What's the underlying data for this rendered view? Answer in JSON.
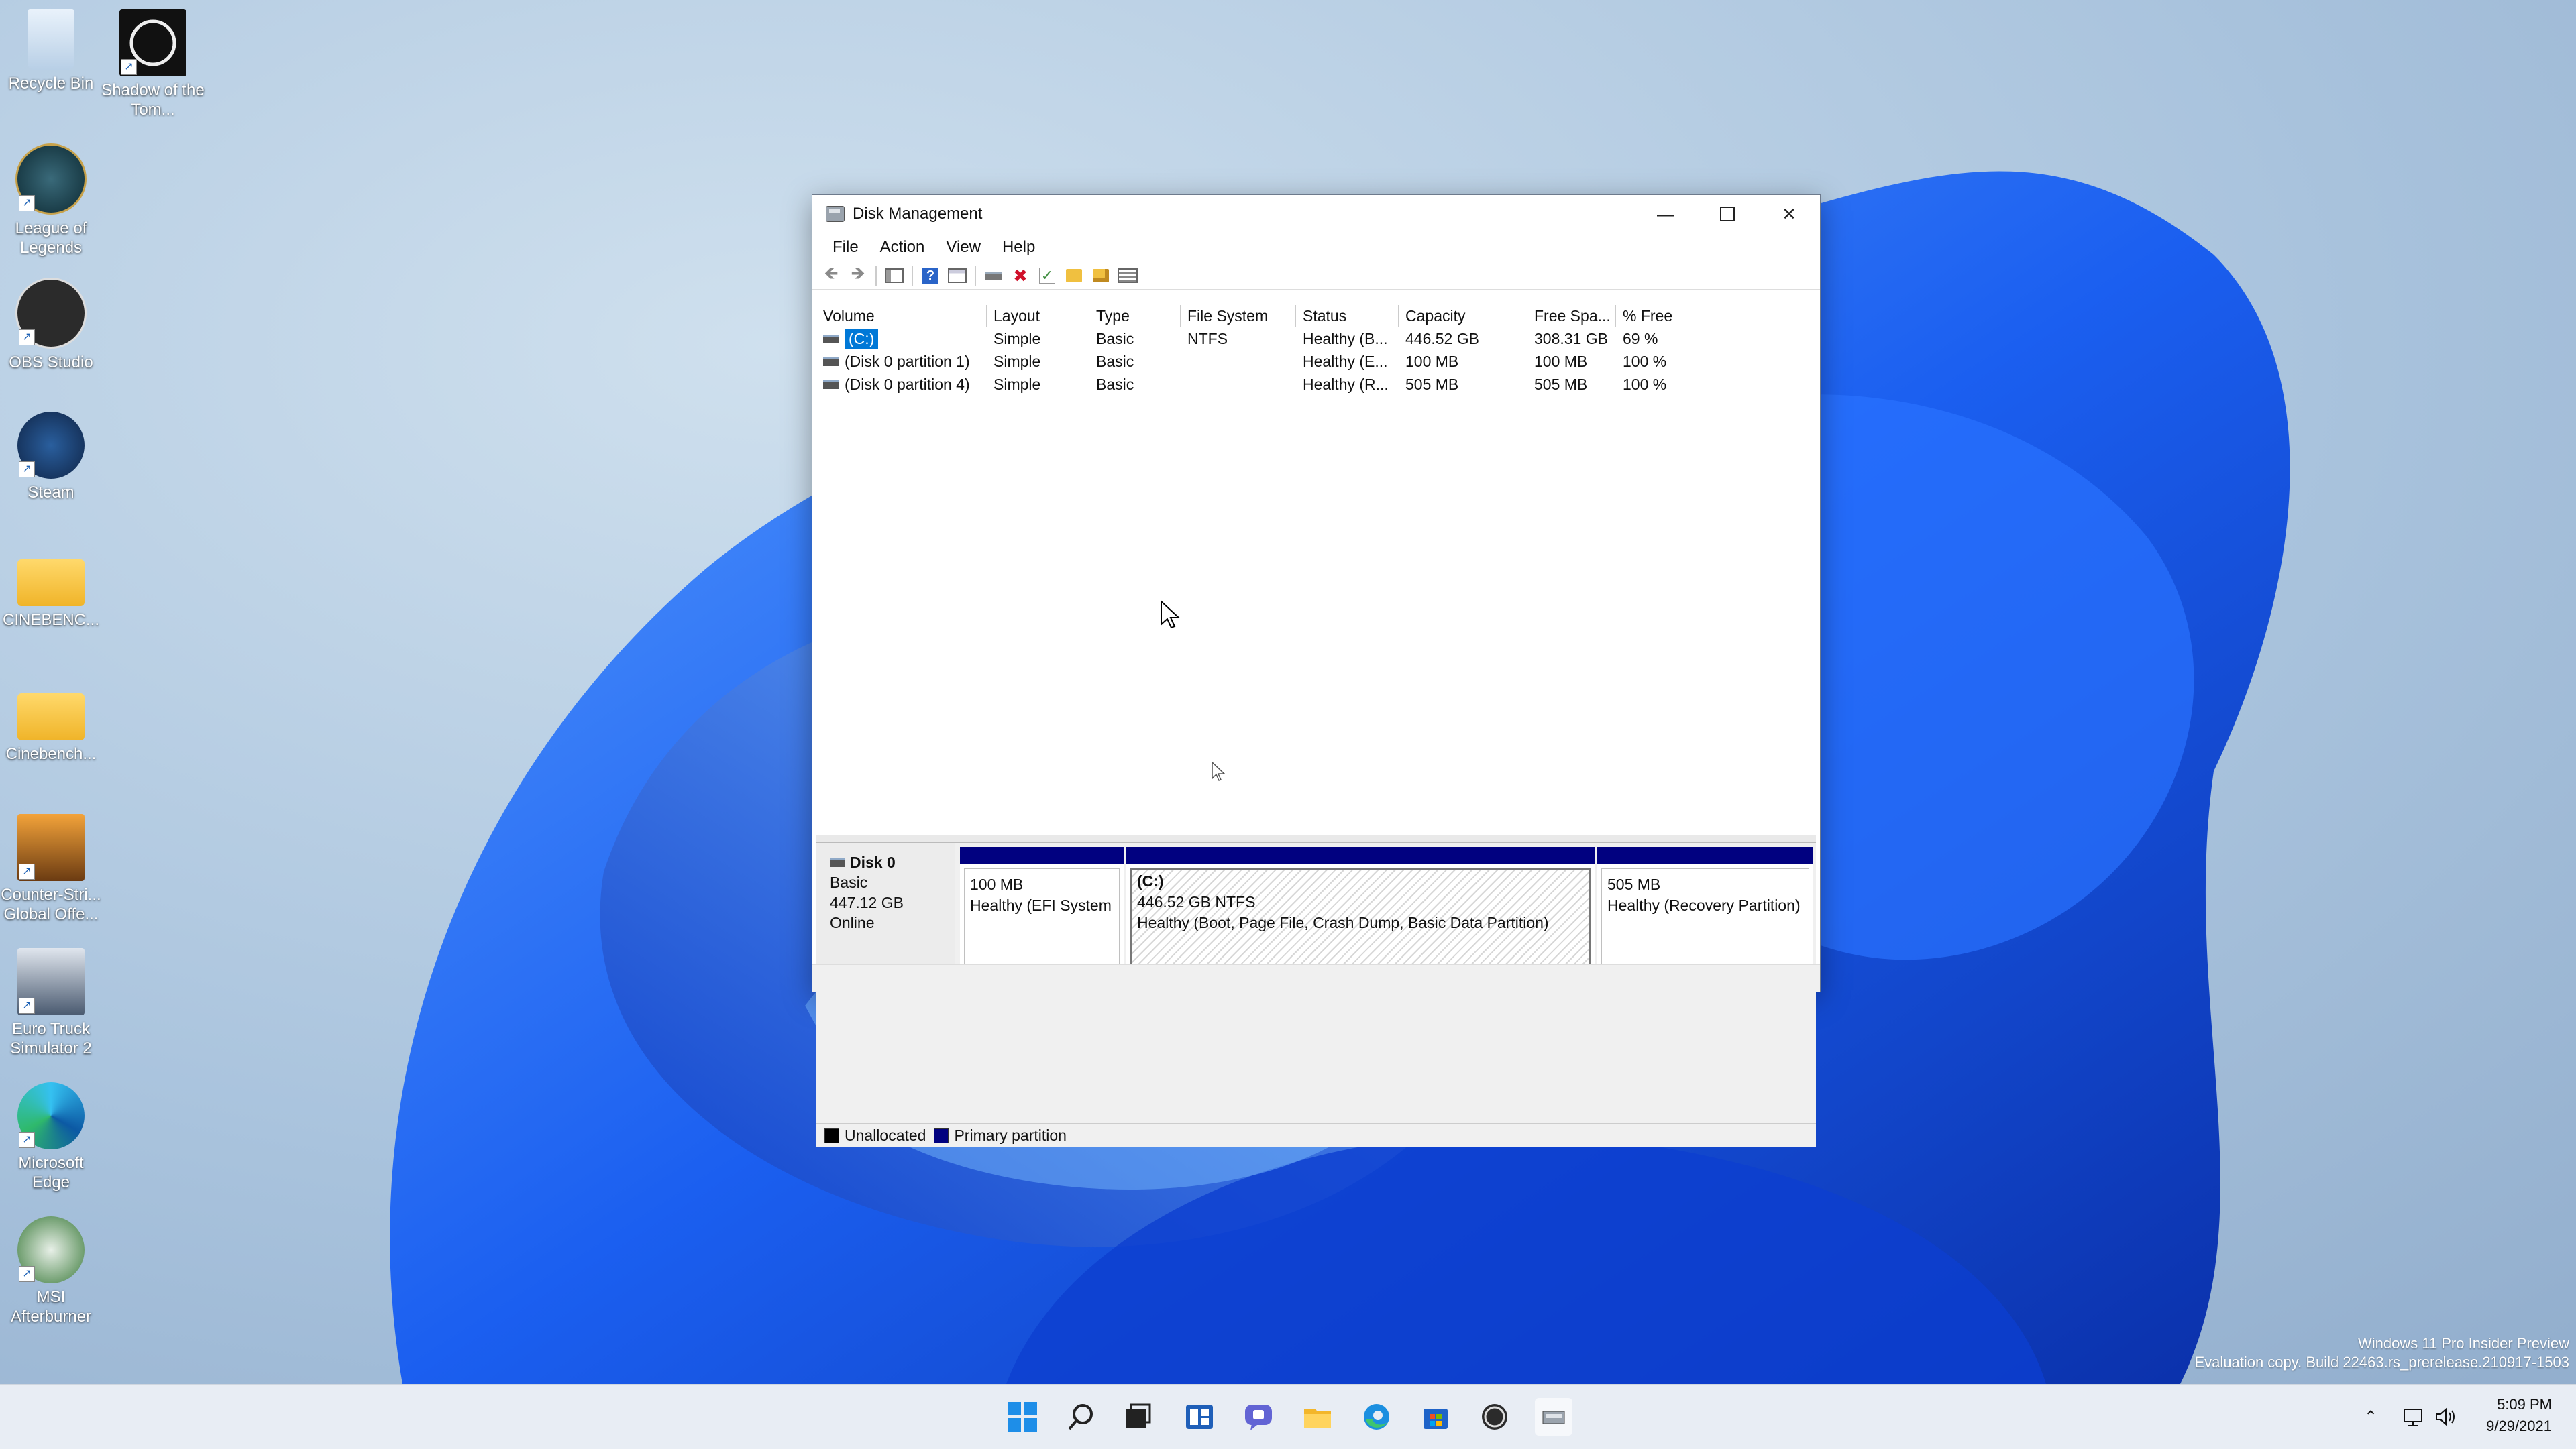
{
  "desktop": {
    "icons": [
      {
        "label": "Recycle Bin"
      },
      {
        "label": "Shadow of the Tom..."
      },
      {
        "label": "League of Legends"
      },
      {
        "label": "OBS Studio"
      },
      {
        "label": "Steam"
      },
      {
        "label": "CINEBENC..."
      },
      {
        "label": "Cinebench..."
      },
      {
        "label": "Counter-Stri... Global Offe..."
      },
      {
        "label": "Euro Truck Simulator 2"
      },
      {
        "label": "Microsoft Edge"
      },
      {
        "label": "MSI Afterburner"
      }
    ]
  },
  "window": {
    "title": "Disk Management",
    "menus": [
      "File",
      "Action",
      "View",
      "Help"
    ],
    "columns": [
      "Volume",
      "Layout",
      "Type",
      "File System",
      "Status",
      "Capacity",
      "Free Spa...",
      "% Free"
    ],
    "volumes": [
      {
        "volume": "(C:)",
        "layout": "Simple",
        "type": "Basic",
        "fs": "NTFS",
        "status": "Healthy (B...",
        "capacity": "446.52 GB",
        "free": "308.31 GB",
        "pct": "69 %"
      },
      {
        "volume": "(Disk 0 partition 1)",
        "layout": "Simple",
        "type": "Basic",
        "fs": "",
        "status": "Healthy (E...",
        "capacity": "100 MB",
        "free": "100 MB",
        "pct": "100 %"
      },
      {
        "volume": "(Disk 0 partition 4)",
        "layout": "Simple",
        "type": "Basic",
        "fs": "",
        "status": "Healthy (R...",
        "capacity": "505 MB",
        "free": "505 MB",
        "pct": "100 %"
      }
    ],
    "disk": {
      "name": "Disk 0",
      "type": "Basic",
      "size": "447.12 GB",
      "state": "Online",
      "partitions": [
        {
          "name": "",
          "size": "100 MB",
          "status": "Healthy (EFI System"
        },
        {
          "name": "(C:)",
          "size": "446.52 GB NTFS",
          "status": "Healthy (Boot, Page File, Crash Dump, Basic Data Partition)"
        },
        {
          "name": "",
          "size": "505 MB",
          "status": "Healthy (Recovery Partition)"
        }
      ]
    },
    "legend": {
      "unallocated": "Unallocated",
      "primary": "Primary partition",
      "unallocated_color": "#000000",
      "primary_color": "#010180"
    }
  },
  "watermark": {
    "line1": "Windows 11 Pro Insider Preview",
    "line2": "Evaluation copy. Build 22463.rs_prerelease.210917-1503"
  },
  "taskbar": {
    "time": "5:09 PM",
    "date": "9/29/2021"
  }
}
